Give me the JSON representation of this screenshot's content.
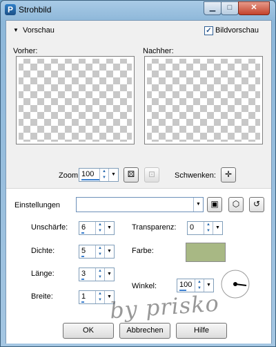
{
  "window": {
    "title": "Strohbild"
  },
  "titlebar": {
    "min_glyph": "▁",
    "max_glyph": "□",
    "close_glyph": "✕"
  },
  "preview": {
    "header_label": "Vorschau",
    "checkbox_label": "Bildvorschau",
    "checkbox_checked": true,
    "before_label": "Vorher:",
    "after_label": "Nachher:"
  },
  "zoom": {
    "label": "Zoom:",
    "value": "100"
  },
  "pan": {
    "label": "Schwenken:"
  },
  "settings": {
    "label": "Einstellungen",
    "value": ""
  },
  "params": {
    "blur": {
      "label": "Unschärfe:",
      "value": "6"
    },
    "density": {
      "label": "Dichte:",
      "value": "5"
    },
    "length": {
      "label": "Länge:",
      "value": "3"
    },
    "width": {
      "label": "Breite:",
      "value": "1"
    },
    "transparency": {
      "label": "Transparenz:",
      "value": "0"
    },
    "color": {
      "label": "Farbe:",
      "swatch": "#a8b884"
    },
    "angle": {
      "label": "Winkel:",
      "value": "100"
    }
  },
  "buttons": {
    "ok": "OK",
    "cancel": "Abbrechen",
    "help": "Hilfe"
  },
  "watermark": "by prisko"
}
